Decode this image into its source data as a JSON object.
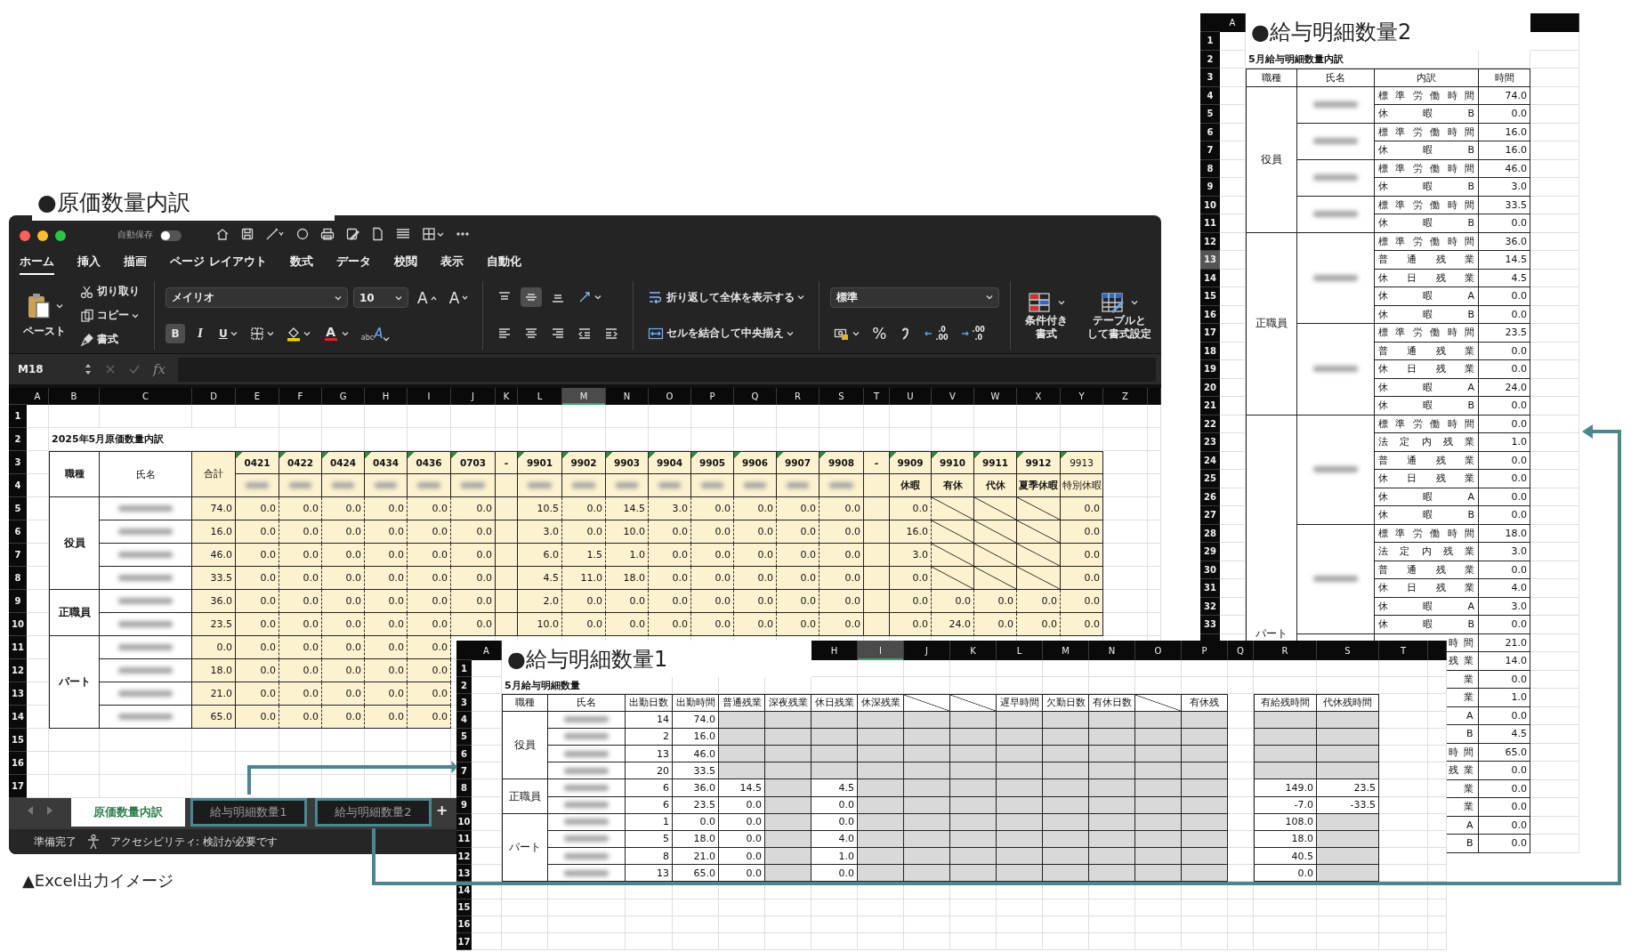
{
  "cost_sheet": {
    "label": "●原価数量内訳",
    "title_bar": {
      "autosave": "自動保存",
      "autosave_on": false
    },
    "menu_tabs": [
      {
        "label": "ホーム",
        "selected": true
      },
      {
        "label": "挿入",
        "selected": false
      },
      {
        "label": "描画",
        "selected": false
      },
      {
        "label": "ページ レイアウト",
        "selected": false
      },
      {
        "label": "数式",
        "selected": false
      },
      {
        "label": "データ",
        "selected": false
      },
      {
        "label": "校閲",
        "selected": false
      },
      {
        "label": "表示",
        "selected": false
      },
      {
        "label": "自動化",
        "selected": false
      }
    ],
    "ribbon": {
      "paste": "ペースト",
      "cut": "切り取り",
      "copy": "コピー",
      "format_painter": "書式",
      "font_name": "メイリオ",
      "font_size": "10",
      "grow_font": "A",
      "shrink_font": "A",
      "styles": [
        {
          "kind": "bold",
          "label": "B",
          "on": true
        },
        {
          "kind": "italic",
          "label": "I",
          "on": false
        },
        {
          "kind": "underline",
          "label": "U",
          "on": false
        }
      ],
      "font_color": "A",
      "phonetic": {
        "small": "abc",
        "large": "A"
      },
      "alignment": [
        {
          "kind": "top",
          "on": false
        },
        {
          "kind": "middle",
          "on": true
        },
        {
          "kind": "bottom",
          "on": false
        },
        {
          "kind": "left",
          "on": false
        },
        {
          "kind": "center",
          "on": false
        },
        {
          "kind": "right",
          "on": false
        }
      ],
      "wrap_text": "折り返して全体を表示する",
      "merge_center": "セルを結合して中央揃え",
      "number_format": "標準",
      "percent": "%",
      "decimals": [
        {
          "kind": "increase",
          "upper": ".0",
          "lower": ".00"
        },
        {
          "kind": "decrease",
          "upper": ".00",
          "lower": ".0"
        }
      ],
      "conditional_format": [
        "条件付き",
        "書式"
      ],
      "format_as_table": [
        "テーブルと",
        "して書式設定"
      ]
    },
    "formula_bar": {
      "cell": "M18",
      "fx": "fx"
    },
    "columns": [
      {
        "label": "A",
        "selected": false
      },
      {
        "label": "B",
        "selected": false
      },
      {
        "label": "C",
        "selected": false
      },
      {
        "label": "D",
        "selected": false
      },
      {
        "label": "E",
        "selected": false
      },
      {
        "label": "F",
        "selected": false
      },
      {
        "label": "G",
        "selected": false
      },
      {
        "label": "H",
        "selected": false
      },
      {
        "label": "I",
        "selected": false
      },
      {
        "label": "J",
        "selected": false
      },
      {
        "label": "K",
        "selected": false
      },
      {
        "label": "L",
        "selected": false
      },
      {
        "label": "M",
        "selected": true
      },
      {
        "label": "N",
        "selected": false
      },
      {
        "label": "O",
        "selected": false
      },
      {
        "label": "P",
        "selected": false
      },
      {
        "label": "Q",
        "selected": false
      },
      {
        "label": "R",
        "selected": false
      },
      {
        "label": "S",
        "selected": false
      },
      {
        "label": "T",
        "selected": false
      },
      {
        "label": "U",
        "selected": false
      },
      {
        "label": "V",
        "selected": false
      },
      {
        "label": "W",
        "selected": false
      },
      {
        "label": "X",
        "selected": false
      },
      {
        "label": "Y",
        "selected": false
      },
      {
        "label": "Z",
        "selected": false
      }
    ],
    "rows": [
      "1",
      "2",
      "3",
      "4",
      "5",
      "6",
      "7",
      "8",
      "9",
      "10",
      "11",
      "12",
      "13",
      "14",
      "15",
      "16",
      "17"
    ],
    "title": "2025年5月原価数量内訳",
    "headers": {
      "type": "職種",
      "name": "氏名",
      "total": "合計",
      "codes": [
        "0421",
        "0422",
        "0424",
        "0434",
        "0436",
        "0703"
      ],
      "separators": [
        "-",
        "-"
      ],
      "items": [
        "9901",
        "9902",
        "9903",
        "9904",
        "9905",
        "9906",
        "9907",
        "9908"
      ],
      "leave_codes": [
        "9909",
        "9910",
        "9911",
        "9912",
        "9913"
      ],
      "leave_names": [
        "休暇",
        "有休",
        "代休",
        "夏季休暇",
        "特別休暇"
      ]
    },
    "groups": [
      {
        "label": "役員",
        "rows": [
          {
            "total": "74.0",
            "codes": [
              "0.0",
              "0.0",
              "0.0",
              "0.0",
              "0.0",
              "0.0"
            ],
            "items": [
              "10.5",
              "0.0",
              "14.5",
              "3.0",
              "0.0",
              "0.0",
              "0.0",
              "0.0"
            ],
            "leave": [
              "0.0",
              "0.0"
            ],
            "slashed": true
          },
          {
            "total": "16.0",
            "codes": [
              "0.0",
              "0.0",
              "0.0",
              "0.0",
              "0.0",
              "0.0"
            ],
            "items": [
              "3.0",
              "0.0",
              "10.0",
              "0.0",
              "0.0",
              "0.0",
              "0.0",
              "0.0"
            ],
            "leave": [
              "16.0",
              "0.0"
            ],
            "slashed": true
          },
          {
            "total": "46.0",
            "codes": [
              "0.0",
              "0.0",
              "0.0",
              "0.0",
              "0.0",
              "0.0"
            ],
            "items": [
              "6.0",
              "1.5",
              "1.0",
              "0.0",
              "0.0",
              "0.0",
              "0.0",
              "0.0"
            ],
            "leave": [
              "3.0",
              "0.0"
            ],
            "slashed": true
          },
          {
            "total": "33.5",
            "codes": [
              "0.0",
              "0.0",
              "0.0",
              "0.0",
              "0.0",
              "0.0"
            ],
            "items": [
              "4.5",
              "11.0",
              "18.0",
              "0.0",
              "0.0",
              "0.0",
              "0.0",
              "0.0"
            ],
            "leave": [
              "0.0",
              "0.0"
            ],
            "slashed": true
          }
        ]
      },
      {
        "label": "正職員",
        "rows": [
          {
            "total": "36.0",
            "codes": [
              "0.0",
              "0.0",
              "0.0",
              "0.0",
              "0.0",
              "0.0"
            ],
            "items": [
              "2.0",
              "0.0",
              "0.0",
              "0.0",
              "0.0",
              "0.0",
              "0.0",
              "0.0"
            ],
            "leave": [
              "0.0",
              "0.0",
              "0.0",
              "0.0",
              "0.0"
            ],
            "slashed": false
          },
          {
            "total": "23.5",
            "codes": [
              "0.0",
              "0.0",
              "0.0",
              "0.0",
              "0.0",
              "0.0"
            ],
            "items": [
              "10.0",
              "0.0",
              "0.0",
              "0.0",
              "0.0",
              "0.0",
              "0.0",
              "0.0"
            ],
            "leave": [
              "0.0",
              "24.0",
              "0.0",
              "0.0",
              "0.0"
            ],
            "slashed": false
          }
        ]
      },
      {
        "label": "パート",
        "rows": [
          {
            "total": "0.0",
            "codes": [
              "0.0",
              "0.0",
              "0.0",
              "0.0",
              "0.0"
            ]
          },
          {
            "total": "18.0",
            "codes": [
              "0.0",
              "0.0",
              "0.0",
              "0.0",
              "0.0"
            ]
          },
          {
            "total": "21.0",
            "codes": [
              "0.0",
              "0.0",
              "0.0",
              "0.0",
              "0.0"
            ]
          },
          {
            "total": "65.0",
            "codes": [
              "0.0",
              "0.0",
              "0.0",
              "0.0",
              "0.0"
            ]
          }
        ]
      }
    ],
    "sheet_tabs": [
      {
        "label": "原価数量内訳",
        "selected": true,
        "highlighted": false
      },
      {
        "label": "給与明細数量1",
        "selected": false,
        "highlighted": true
      },
      {
        "label": "給与明細数量2",
        "selected": false,
        "highlighted": true
      }
    ],
    "add_sheet": "+",
    "status": "準備完了",
    "accessibility": "アクセシビリティ: 検討が必要です"
  },
  "pay_sheet_1": {
    "label": "●給与明細数量1",
    "columns": [
      {
        "label": "A",
        "selected": false
      },
      {
        "label": "H",
        "selected": false
      },
      {
        "label": "I",
        "selected": true
      },
      {
        "label": "J",
        "selected": false
      },
      {
        "label": "K",
        "selected": false
      },
      {
        "label": "L",
        "selected": false
      },
      {
        "label": "M",
        "selected": false
      },
      {
        "label": "N",
        "selected": false
      },
      {
        "label": "O",
        "selected": false
      },
      {
        "label": "P",
        "selected": false
      },
      {
        "label": "Q",
        "selected": false
      },
      {
        "label": "R",
        "selected": false
      },
      {
        "label": "S",
        "selected": false
      },
      {
        "label": "T",
        "selected": false
      }
    ],
    "rows": [
      "1",
      "2",
      "3",
      "4",
      "5",
      "6",
      "7",
      "8",
      "9",
      "10",
      "11",
      "12",
      "13",
      "14",
      "15",
      "16",
      "17"
    ],
    "title": "5月給与明細数量",
    "type_header": "職種",
    "name_header": "氏名",
    "headers": [
      {
        "kind": "text",
        "label": "出勤日数"
      },
      {
        "kind": "text",
        "label": "出勤時間"
      },
      {
        "kind": "text",
        "label": "普通残業"
      },
      {
        "kind": "text",
        "label": "深夜残業"
      },
      {
        "kind": "text",
        "label": "休日残業"
      },
      {
        "kind": "text",
        "label": "休深残業"
      },
      {
        "kind": "slash"
      },
      {
        "kind": "slash"
      },
      {
        "kind": "text",
        "label": "遅早時間"
      },
      {
        "kind": "text",
        "label": "欠勤日数"
      },
      {
        "kind": "text",
        "label": "有休日数"
      },
      {
        "kind": "slash"
      },
      {
        "kind": "text",
        "label": "有休残"
      }
    ],
    "balance_headers": [
      "有給残時間",
      "代休残時間"
    ],
    "groups": [
      {
        "label": "役員",
        "rows": [
          {
            "days": "14",
            "hours": "74.0"
          },
          {
            "days": "2",
            "hours": "16.0"
          },
          {
            "days": "13",
            "hours": "46.0"
          },
          {
            "days": "20",
            "hours": "33.5"
          }
        ]
      },
      {
        "label": "正職員",
        "rows": [
          {
            "days": "6",
            "hours": "36.0",
            "overtime": "14.5",
            "holiday_overtime": "4.5",
            "paid_leave_balance": "149.0",
            "comp_leave_balance": "23.5"
          },
          {
            "days": "6",
            "hours": "23.5",
            "overtime": "0.0",
            "holiday_overtime": "0.0",
            "paid_leave_balance": "-7.0",
            "comp_leave_balance": "-33.5"
          }
        ]
      },
      {
        "label": "パート",
        "rows": [
          {
            "days": "1",
            "hours": "0.0",
            "overtime": "0.0",
            "holiday_overtime": "0.0",
            "paid_leave_balance": "108.0"
          },
          {
            "days": "5",
            "hours": "18.0",
            "overtime": "0.0",
            "holiday_overtime": "4.0",
            "paid_leave_balance": "18.0"
          },
          {
            "days": "8",
            "hours": "21.0",
            "overtime": "0.0",
            "holiday_overtime": "1.0",
            "paid_leave_balance": "40.5"
          },
          {
            "days": "13",
            "hours": "65.0",
            "overtime": "0.0",
            "holiday_overtime": "0.0",
            "paid_leave_balance": "0.0"
          }
        ]
      }
    ]
  },
  "pay_sheet_2": {
    "label": "●給与明細数量2",
    "columns": [
      {
        "label": "A",
        "selected": false
      }
    ],
    "rows": [
      {
        "label": "1",
        "selected": false
      },
      {
        "label": "2",
        "selected": false
      },
      {
        "label": "3",
        "selected": false
      },
      {
        "label": "4",
        "selected": false
      },
      {
        "label": "5",
        "selected": false
      },
      {
        "label": "6",
        "selected": false
      },
      {
        "label": "7",
        "selected": false
      },
      {
        "label": "8",
        "selected": false
      },
      {
        "label": "9",
        "selected": false
      },
      {
        "label": "10",
        "selected": false
      },
      {
        "label": "11",
        "selected": false
      },
      {
        "label": "12",
        "selected": false
      },
      {
        "label": "13",
        "selected": true
      },
      {
        "label": "14",
        "selected": false
      },
      {
        "label": "15",
        "selected": false
      },
      {
        "label": "16",
        "selected": false
      },
      {
        "label": "17",
        "selected": false
      },
      {
        "label": "18",
        "selected": false
      },
      {
        "label": "19",
        "selected": false
      },
      {
        "label": "20",
        "selected": false
      },
      {
        "label": "21",
        "selected": false
      },
      {
        "label": "22",
        "selected": false
      },
      {
        "label": "23",
        "selected": false
      },
      {
        "label": "24",
        "selected": false
      },
      {
        "label": "25",
        "selected": false
      },
      {
        "label": "26",
        "selected": false
      },
      {
        "label": "27",
        "selected": false
      },
      {
        "label": "28",
        "selected": false
      },
      {
        "label": "29",
        "selected": false
      },
      {
        "label": "30",
        "selected": false
      },
      {
        "label": "31",
        "selected": false
      },
      {
        "label": "32",
        "selected": false
      },
      {
        "label": "33",
        "selected": false
      }
    ],
    "title": "5月給与明細数量内訳",
    "headers": [
      "職種",
      "氏名",
      "内訳",
      "時間"
    ],
    "groups": [
      {
        "label": "役員",
        "employees": [
          {
            "hidden": false,
            "entries": [
              {
                "label": "標準労働時間",
                "time": "74.0"
              },
              {
                "label": "休暇B",
                "time": "0.0"
              }
            ]
          },
          {
            "hidden": false,
            "entries": [
              {
                "label": "標準労働時間",
                "time": "16.0"
              },
              {
                "label": "休暇B",
                "time": "16.0"
              }
            ]
          },
          {
            "hidden": false,
            "entries": [
              {
                "label": "標準労働時間",
                "time": "46.0"
              },
              {
                "label": "休暇B",
                "time": "3.0"
              }
            ]
          },
          {
            "hidden": false,
            "entries": [
              {
                "label": "標準労働時間",
                "time": "33.5"
              },
              {
                "label": "休暇B",
                "time": "0.0"
              }
            ]
          }
        ]
      },
      {
        "label": "正職員",
        "employees": [
          {
            "hidden": false,
            "entries": [
              {
                "label": "標準労働時間",
                "time": "36.0"
              },
              {
                "label": "普通残業",
                "time": "14.5"
              },
              {
                "label": "休日残業",
                "time": "4.5"
              },
              {
                "label": "休暇A",
                "time": "0.0"
              },
              {
                "label": "休暇B",
                "time": "0.0"
              }
            ]
          },
          {
            "hidden": false,
            "entries": [
              {
                "label": "標準労働時間",
                "time": "23.5"
              },
              {
                "label": "普通残業",
                "time": "0.0"
              },
              {
                "label": "休日残業",
                "time": "0.0"
              },
              {
                "label": "休暇A",
                "time": "24.0"
              },
              {
                "label": "休暇B",
                "time": "0.0"
              }
            ]
          }
        ]
      },
      {
        "label": "パート",
        "employees": [
          {
            "hidden": false,
            "entries": [
              {
                "label": "標準労働時間",
                "time": "0.0"
              },
              {
                "label": "法定内残業",
                "time": "1.0"
              },
              {
                "label": "普通残業",
                "time": "0.0"
              },
              {
                "label": "休日残業",
                "time": "0.0"
              },
              {
                "label": "休暇A",
                "time": "0.0"
              },
              {
                "label": "休暇B",
                "time": "0.0"
              }
            ]
          },
          {
            "hidden": false,
            "entries": [
              {
                "label": "標準労働時間",
                "time": "18.0"
              },
              {
                "label": "法定内残業",
                "time": "3.0"
              },
              {
                "label": "普通残業",
                "time": "0.0"
              },
              {
                "label": "休日残業",
                "time": "4.0"
              },
              {
                "label": "休暇A",
                "time": "3.0"
              },
              {
                "label": "休暇B",
                "time": "0.0"
              }
            ]
          },
          {
            "hidden": true,
            "entries": [
              {
                "label": "時間",
                "time": "21.0"
              },
              {
                "label": "残業",
                "time": "14.0"
              },
              {
                "label": "業",
                "time": "0.0"
              },
              {
                "label": "業",
                "time": "1.0"
              },
              {
                "label": "A",
                "time": "0.0"
              },
              {
                "label": "B",
                "time": "4.5"
              }
            ]
          },
          {
            "hidden": true,
            "entries": [
              {
                "label": "時間",
                "time": "65.0"
              },
              {
                "label": "残業",
                "time": "0.0"
              },
              {
                "label": "業",
                "time": "0.0"
              },
              {
                "label": "業",
                "time": "0.0"
              },
              {
                "label": "A",
                "time": "0.0"
              },
              {
                "label": "B",
                "time": "0.0"
              }
            ]
          }
        ]
      }
    ]
  },
  "caption": "▲Excel出力イメージ"
}
